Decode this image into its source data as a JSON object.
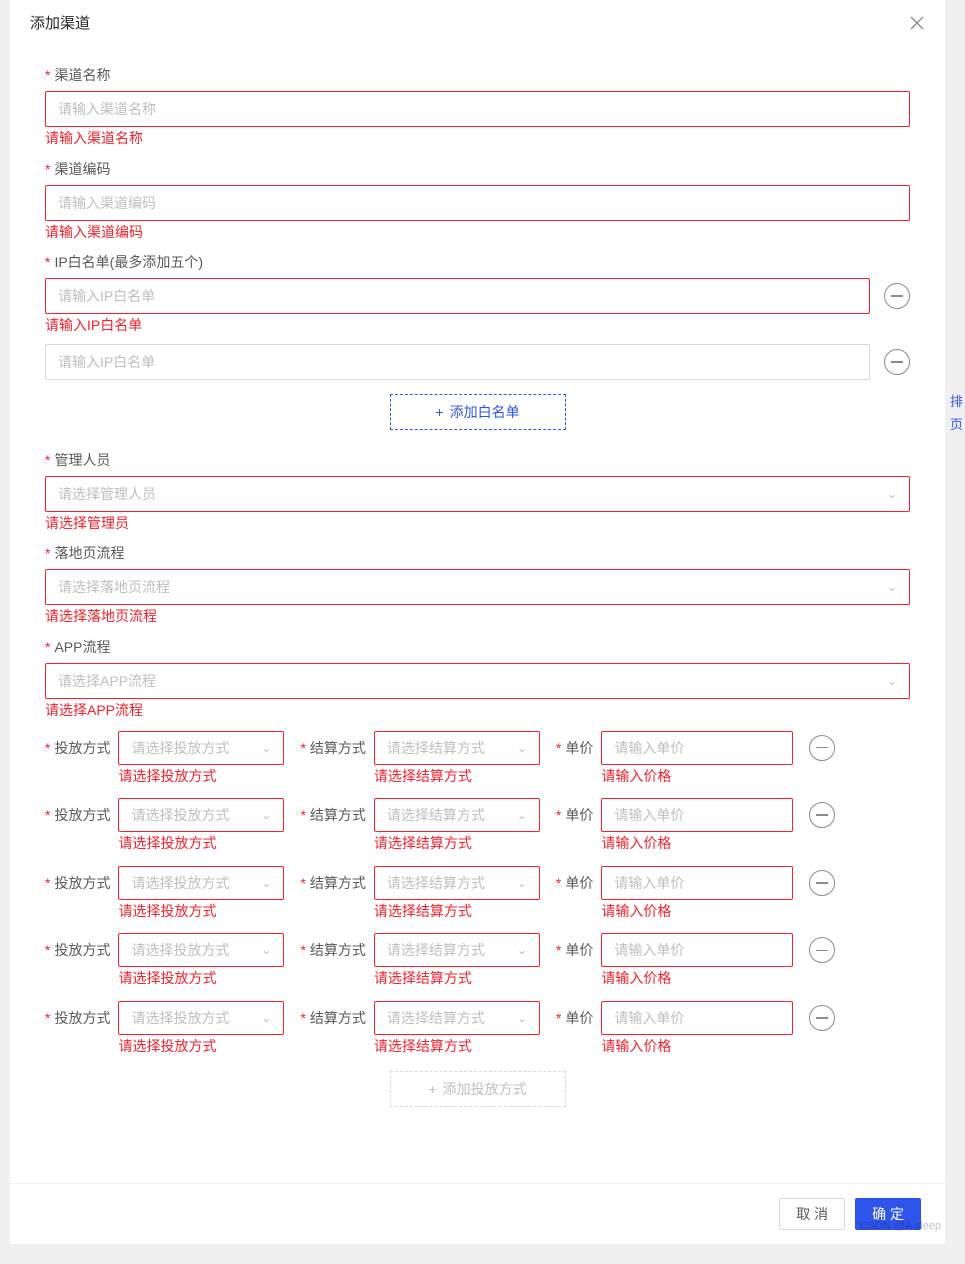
{
  "modal": {
    "title": "添加渠道",
    "close_icon": "close-icon"
  },
  "bg_hints": [
    "排",
    "页"
  ],
  "form": {
    "channel_name": {
      "label": "渠道名称",
      "placeholder": "请输入渠道名称",
      "error": "请输入渠道名称"
    },
    "channel_code": {
      "label": "渠道编码",
      "placeholder": "请输入渠道编码",
      "error": "请输入渠道编码"
    },
    "ip_whitelist": {
      "label": "IP白名单(最多添加五个)",
      "placeholder": "请输入IP白名单",
      "rows": [
        {
          "error": "请输入IP白名单",
          "has_error": true
        },
        {
          "error": "",
          "has_error": false
        }
      ],
      "add_btn": "添加白名单"
    },
    "admin": {
      "label": "管理人员",
      "placeholder": "请选择管理人员",
      "error": "请选择管理员"
    },
    "landing_flow": {
      "label": "落地页流程",
      "placeholder": "请选择落地页流程",
      "error": "请选择落地页流程"
    },
    "app_flow": {
      "label": "APP流程",
      "placeholder": "请选择APP流程",
      "error": "请选择APP流程"
    },
    "modes": {
      "launch_label": "投放方式",
      "launch_placeholder": "请选择投放方式",
      "launch_error": "请选择投放方式",
      "settle_label": "结算方式",
      "settle_placeholder": "请选择结算方式",
      "settle_error": "请选择结算方式",
      "price_label": "单价",
      "price_placeholder": "请输入单价",
      "price_error": "请输入价格",
      "row_count": 5,
      "add_btn": "添加投放方式"
    }
  },
  "footer": {
    "cancel": "取 消",
    "confirm": "确 定"
  },
  "watermark": "CSDN @A sleep"
}
